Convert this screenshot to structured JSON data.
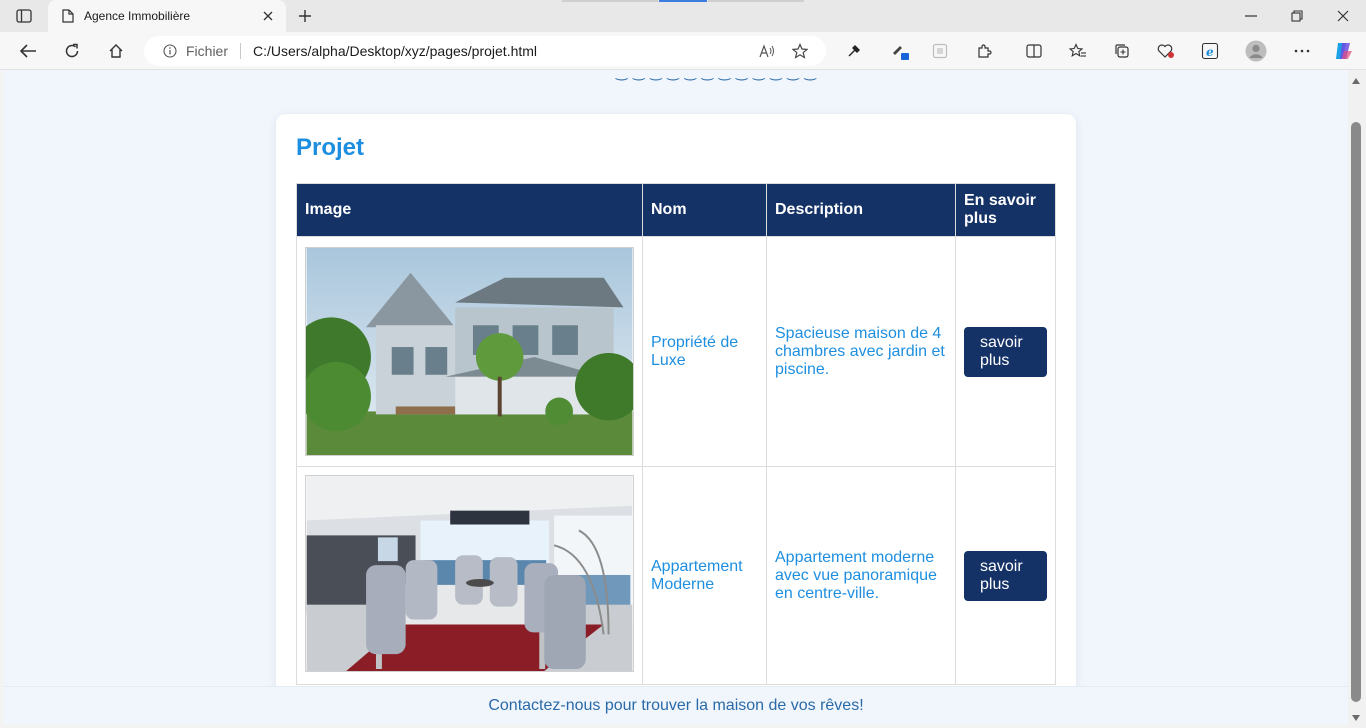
{
  "browser": {
    "tab_title": "Agence Immobilière",
    "address_label": "Fichier",
    "url": "C:/Users/alpha/Desktop/xyz/pages/projet.html",
    "accent_color": "#1e8fe0"
  },
  "page": {
    "title": "Projet",
    "table": {
      "headers": [
        "Image",
        "Nom",
        "Description",
        "En savoir plus"
      ],
      "rows": [
        {
          "image": "luxury-house-photo",
          "name": "Propriété de Luxe",
          "description": "Spacieuse maison de 4 chambres avec jardin et piscine.",
          "button": "savoir plus"
        },
        {
          "image": "modern-apartment-photo",
          "name": "Appartement Moderne",
          "description": "Appartement moderne avec vue panoramique en centre-ville.",
          "button": "savoir plus"
        }
      ]
    },
    "footer_text": "Contactez-nous pour trouver la maison de vos rêves!",
    "header_color": "#153266"
  }
}
